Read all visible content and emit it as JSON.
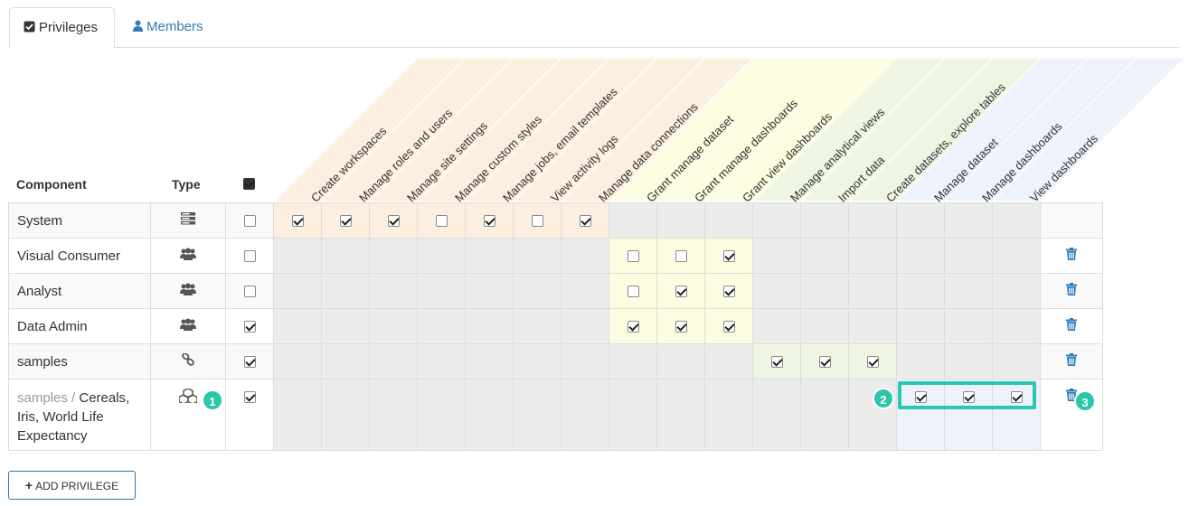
{
  "tabs": [
    {
      "label": "Privileges",
      "icon": "check-square-icon",
      "active": true
    },
    {
      "label": "Members",
      "icon": "user-icon",
      "active": false
    }
  ],
  "headers": {
    "component": "Component",
    "type": "Type"
  },
  "privilege_columns": [
    {
      "label": "Create workspaces",
      "group": "orange"
    },
    {
      "label": "Manage roles and users",
      "group": "orange"
    },
    {
      "label": "Manage site settings",
      "group": "orange"
    },
    {
      "label": "Manage custom styles",
      "group": "orange"
    },
    {
      "label": "Manage jobs, email templates",
      "group": "orange"
    },
    {
      "label": "View activity logs",
      "group": "orange"
    },
    {
      "label": "Manage data connections",
      "group": "orange"
    },
    {
      "label": "Grant manage dataset",
      "group": "yellow"
    },
    {
      "label": "Grant manage dashboards",
      "group": "yellow"
    },
    {
      "label": "Grant view dashboards",
      "group": "yellow"
    },
    {
      "label": "Manage analytical views",
      "group": "green"
    },
    {
      "label": "Import data",
      "group": "green"
    },
    {
      "label": "Create datasets, explore tables",
      "group": "green"
    },
    {
      "label": "Manage dataset",
      "group": "blue"
    },
    {
      "label": "Manage dashboards",
      "group": "blue"
    },
    {
      "label": "View dashboards",
      "group": "blue"
    }
  ],
  "group_colors": {
    "orange": "#fcefdf",
    "yellow": "#fbfce0",
    "green": "#eef6e3",
    "blue": "#edf2fb",
    "gray": "#ececec"
  },
  "rows": [
    {
      "component": "System",
      "type_icon": "server-icon",
      "all": false,
      "cells": [
        true,
        true,
        true,
        false,
        true,
        false,
        true,
        null,
        null,
        null,
        null,
        null,
        null,
        null,
        null,
        null
      ],
      "deletable": false
    },
    {
      "component": "Visual Consumer",
      "type_icon": "users-icon",
      "all": false,
      "cells": [
        null,
        null,
        null,
        null,
        null,
        null,
        null,
        false,
        false,
        true,
        null,
        null,
        null,
        null,
        null,
        null
      ],
      "deletable": true
    },
    {
      "component": "Analyst",
      "type_icon": "users-icon",
      "all": false,
      "cells": [
        null,
        null,
        null,
        null,
        null,
        null,
        null,
        false,
        true,
        true,
        null,
        null,
        null,
        null,
        null,
        null
      ],
      "deletable": true
    },
    {
      "component": "Data Admin",
      "type_icon": "users-icon",
      "all": true,
      "cells": [
        null,
        null,
        null,
        null,
        null,
        null,
        null,
        true,
        true,
        true,
        null,
        null,
        null,
        null,
        null,
        null
      ],
      "deletable": true
    },
    {
      "component": "samples",
      "type_icon": "link-icon",
      "all": true,
      "cells": [
        null,
        null,
        null,
        null,
        null,
        null,
        null,
        null,
        null,
        null,
        true,
        true,
        true,
        null,
        null,
        null
      ],
      "deletable": true
    },
    {
      "component_prefix": "samples /",
      "component": "Cereals, Iris, World Life Expectancy",
      "type_icon": "cubes-icon",
      "all": true,
      "cells": [
        null,
        null,
        null,
        null,
        null,
        null,
        null,
        null,
        null,
        null,
        null,
        null,
        null,
        true,
        true,
        true
      ],
      "deletable": true
    }
  ],
  "badges": [
    "1",
    "2",
    "3"
  ],
  "add_button": "ADD PRIVILEGE"
}
